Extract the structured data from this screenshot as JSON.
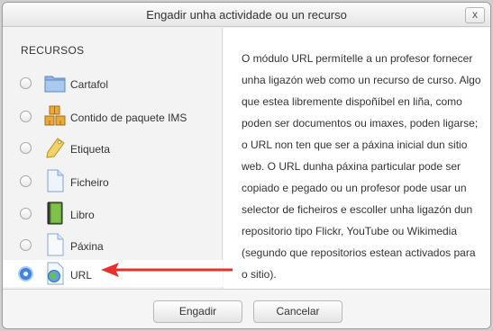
{
  "dialog": {
    "title": "Engadir unha actividade ou un recurso",
    "close_label": "x"
  },
  "resources": {
    "heading": "RECURSOS",
    "items": [
      {
        "label": "Cartafol",
        "icon": "folder-icon",
        "selected": false
      },
      {
        "label": "Contido de paquete IMS",
        "icon": "package-icon",
        "selected": false
      },
      {
        "label": "Etiqueta",
        "icon": "label-tag-icon",
        "selected": false
      },
      {
        "label": "Ficheiro",
        "icon": "file-icon",
        "selected": false
      },
      {
        "label": "Libro",
        "icon": "book-icon",
        "selected": false
      },
      {
        "label": "Páxina",
        "icon": "page-icon",
        "selected": false
      },
      {
        "label": "URL",
        "icon": "url-globe-icon",
        "selected": true
      }
    ]
  },
  "description": {
    "text": "O módulo URL permítelle a un profesor fornecer unha ligazón web como un recurso de curso. Algo que estea libremente dispoñíbel en liña, como poden ser documentos ou imaxes, poden ligarse; o URL non ten que ser a páxina inicial dun sitio web. O URL dunha páxina particular pode ser copiado e pegado ou un profesor pode usar un selector de ficheiros e escoller unha ligazón dun repositorio tipo Flickr, YouTube ou Wikimedia (segundo que repositorios estean activados para o sitio)."
  },
  "footer": {
    "add_label": "Engadir",
    "cancel_label": "Cancelar"
  },
  "colors": {
    "annotation_arrow": "#e8312b",
    "radio_selected": "#3d86e6"
  }
}
